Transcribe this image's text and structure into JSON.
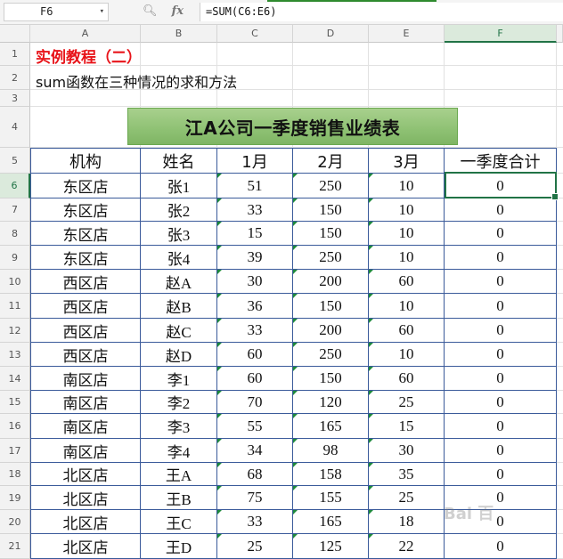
{
  "name_box": "F6",
  "formula": "=SUM(C6:E6)",
  "fx_label": "fx",
  "columns": [
    "A",
    "B",
    "C",
    "D",
    "E",
    "F"
  ],
  "rows": [
    "1",
    "2",
    "3",
    "4",
    "5",
    "6",
    "7",
    "8",
    "9",
    "10",
    "11",
    "12",
    "13",
    "14",
    "15",
    "16",
    "17",
    "18",
    "19",
    "20",
    "21"
  ],
  "sheet": {
    "title": "实例教程（二）",
    "subtitle": "sum函数在三种情况的求和方法",
    "table_title": "江A公司一季度销售业绩表",
    "headers": [
      "机构",
      "姓名",
      "1月",
      "2月",
      "3月",
      "一季度合计"
    ],
    "records": [
      [
        "东区店",
        "张1",
        "51",
        "250",
        "10",
        "0"
      ],
      [
        "东区店",
        "张2",
        "33",
        "150",
        "10",
        "0"
      ],
      [
        "东区店",
        "张3",
        "15",
        "150",
        "10",
        "0"
      ],
      [
        "东区店",
        "张4",
        "39",
        "250",
        "10",
        "0"
      ],
      [
        "西区店",
        "赵A",
        "30",
        "200",
        "60",
        "0"
      ],
      [
        "西区店",
        "赵B",
        "36",
        "150",
        "10",
        "0"
      ],
      [
        "西区店",
        "赵C",
        "33",
        "200",
        "60",
        "0"
      ],
      [
        "西区店",
        "赵D",
        "60",
        "250",
        "10",
        "0"
      ],
      [
        "南区店",
        "李1",
        "60",
        "150",
        "60",
        "0"
      ],
      [
        "南区店",
        "李2",
        "70",
        "120",
        "25",
        "0"
      ],
      [
        "南区店",
        "李3",
        "55",
        "165",
        "15",
        "0"
      ],
      [
        "南区店",
        "李4",
        "34",
        "98",
        "30",
        "0"
      ],
      [
        "北区店",
        "王A",
        "68",
        "158",
        "35",
        "0"
      ],
      [
        "北区店",
        "王B",
        "75",
        "155",
        "25",
        "0"
      ],
      [
        "北区店",
        "王C",
        "33",
        "165",
        "18",
        "0"
      ],
      [
        "北区店",
        "王D",
        "25",
        "125",
        "22",
        "0"
      ]
    ]
  },
  "watermark": "Bai 百"
}
